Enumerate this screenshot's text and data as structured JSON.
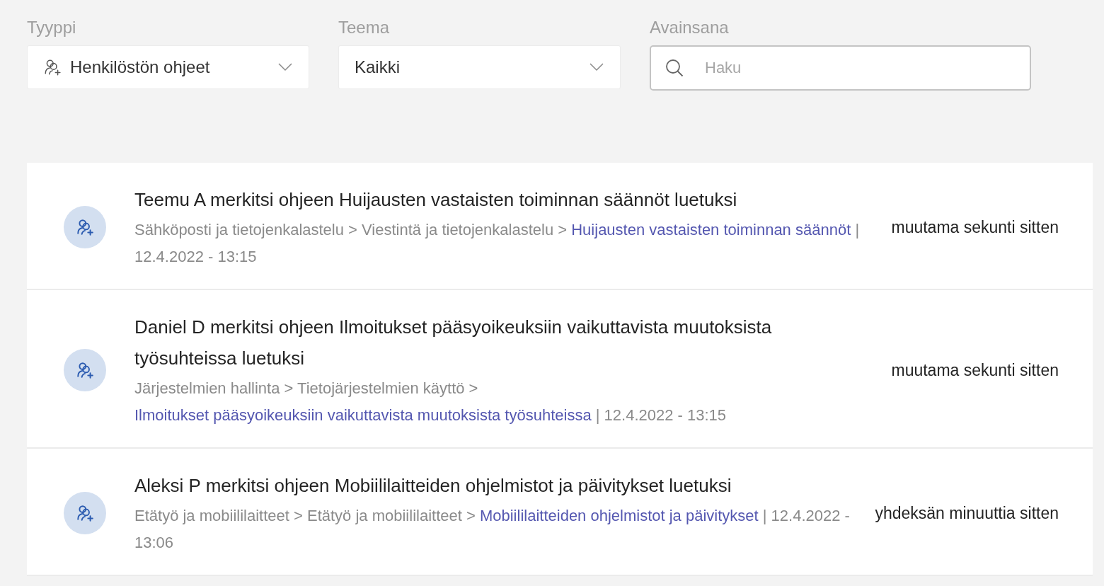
{
  "filters": [
    {
      "kind": "dropdown",
      "label": "Tyyppi",
      "value": "Henkilöstön ohjeet",
      "icon": true
    },
    {
      "kind": "dropdown",
      "label": "Teema",
      "value": "Kaikki",
      "icon": false
    },
    {
      "kind": "search",
      "label": "Avainsana",
      "placeholder": "Haku"
    }
  ],
  "activity": [
    {
      "title": "Teemu A merkitsi ohjeen Huijausten vastaisten toiminnan säännöt luetuksi",
      "path": [
        "Sähköposti ja tietojenkalastelu",
        "Viestintä ja tietojenkalastelu"
      ],
      "separator": ">",
      "link": "Huijausten vastaisten toiminnan säännöt",
      "date_divider": "|",
      "date": "12.4.2022 - 13:15",
      "time": "muutama sekunti sitten"
    },
    {
      "title": "Daniel D merkitsi ohjeen Ilmoitukset pääsyoikeuksiin vaikuttavista muutoksista työsuhteissa luetuksi",
      "path": [
        "Järjestelmien hallinta",
        "Tietojärjestelmien käyttö"
      ],
      "separator": ">",
      "link": "Ilmoitukset pääsyoikeuksiin vaikuttavista muutoksista työsuhteissa",
      "date_divider": "|",
      "date": "12.4.2022 - 13:15",
      "time": "muutama sekunti sitten"
    },
    {
      "title": "Aleksi P merkitsi ohjeen Mobiililaitteiden ohjelmistot ja päivitykset luetuksi",
      "path": [
        "Etätyö ja mobiililaitteet",
        "Etätyö ja mobiililaitteet"
      ],
      "separator": ">",
      "link": "Mobiililaitteiden ohjelmistot ja päivitykset",
      "date_divider": "|",
      "date": "12.4.2022 - 13:06",
      "time": "yhdeksän minuuttia sitten"
    }
  ]
}
